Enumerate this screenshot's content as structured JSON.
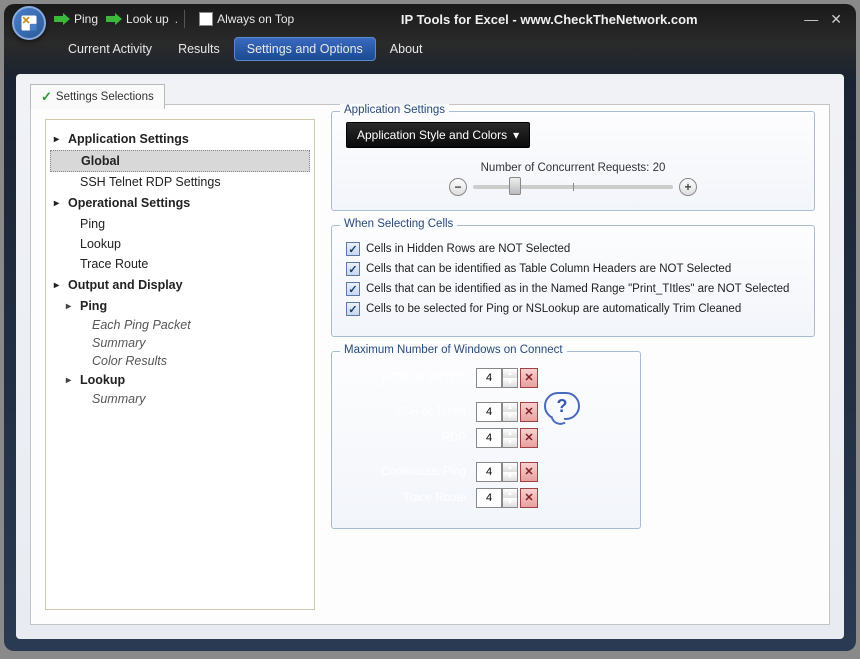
{
  "title": "IP Tools for Excel - www.CheckTheNetwork.com",
  "toolbar": {
    "ping": "Ping",
    "lookup": "Look up",
    "always_on_top": "Always on Top"
  },
  "menu": {
    "items": [
      "Current Activity",
      "Results",
      "Settings and Options",
      "About"
    ],
    "active_index": 2
  },
  "tab_label": "Settings Selections",
  "tree": {
    "app_settings": "Application Settings",
    "global": "Global",
    "ssh": "SSH  Telnet  RDP Settings",
    "op_settings": "Operational Settings",
    "ping": "Ping",
    "lookup": "Lookup",
    "trace": "Trace Route",
    "out_disp": "Output and Display",
    "ping2": "Ping",
    "each_packet": "Each Ping Packet",
    "summary": "Summary",
    "color_results": "Color Results",
    "lookup2": "Lookup",
    "summary2": "Summary"
  },
  "right": {
    "app_settings_legend": "Application Settings",
    "style_btn": "Application Style and Colors",
    "concurrent_label": "Number of Concurrent Requests: 20",
    "selecting_legend": "When Selecting Cells",
    "cb1": "Cells in Hidden Rows are NOT Selected",
    "cb2": "Cells that can be identified as Table Column Headers are NOT Selected",
    "cb3": "Cells that can be identified as in the Named Range \"Print_TItles\" are NOT Selected",
    "cb4": "Cells to be selected for Ping or NSLookup are automatically Trim Cleaned",
    "maxwin_legend": "Maximum Number of Windows on Connect",
    "rows": [
      {
        "label": "HTTP or HTTPS",
        "value": "4"
      },
      {
        "label": "SSH or Telnet",
        "value": "4"
      },
      {
        "label": "RDP",
        "value": "4"
      },
      {
        "label": "Continuous Ping",
        "value": "4"
      },
      {
        "label": "Trace Route",
        "value": "4"
      }
    ],
    "help": "?"
  }
}
